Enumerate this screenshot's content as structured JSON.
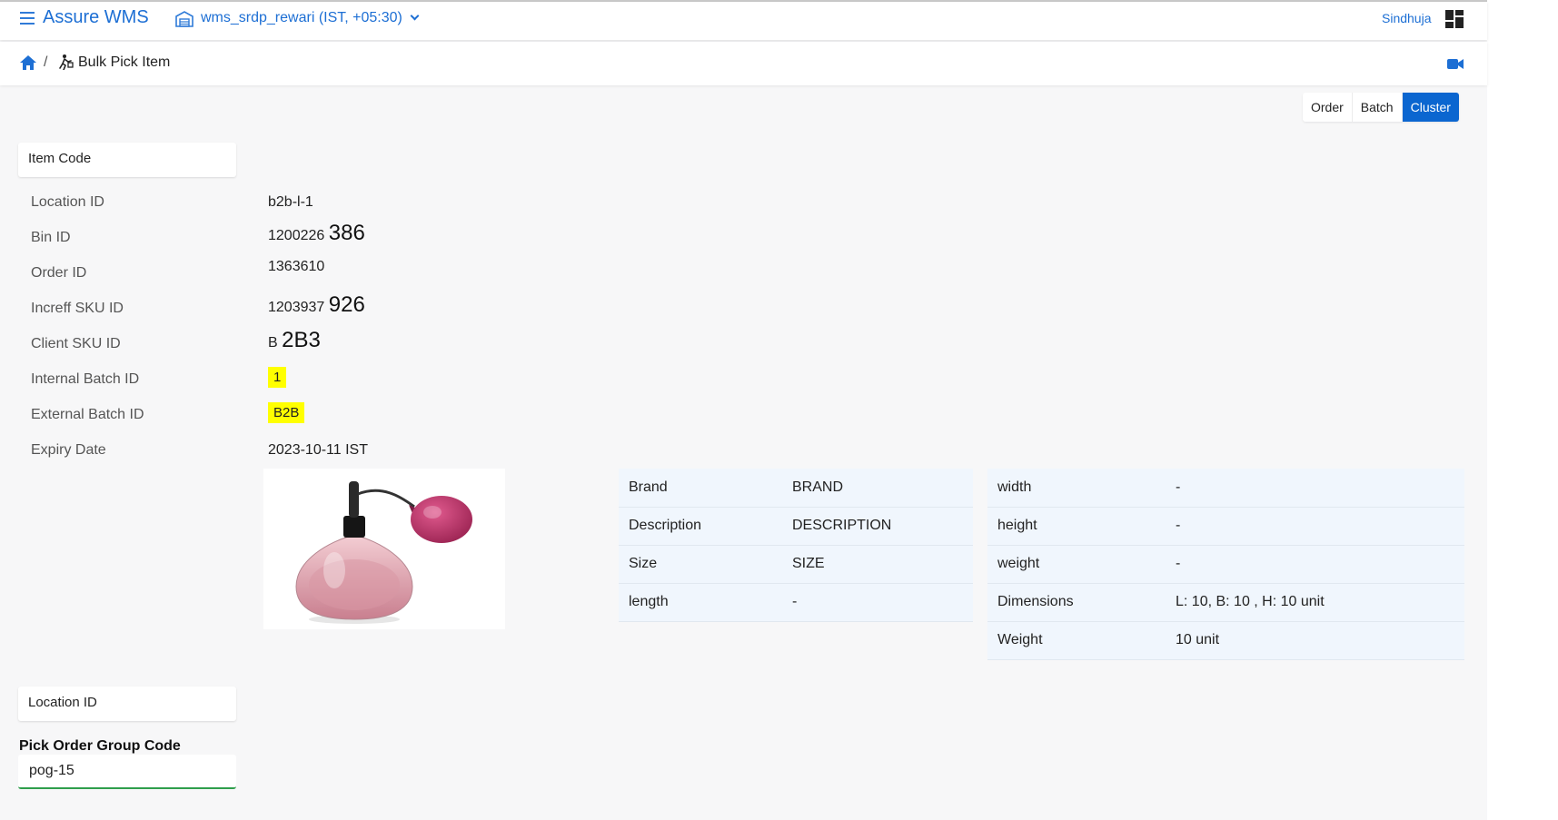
{
  "header": {
    "app_name": "Assure WMS",
    "warehouse": "wms_srdp_rewari",
    "timezone": "(IST, +05:30)",
    "user": "Sindhuja"
  },
  "breadcrumb": {
    "separator": "/",
    "title": "Bulk Pick Item"
  },
  "pick_modes": {
    "options": [
      "Order",
      "Batch",
      "Cluster"
    ],
    "selected": "Cluster"
  },
  "item_code_input": {
    "placeholder": "Item Code"
  },
  "item_info": {
    "location_id": {
      "label": "Location ID",
      "value": "b2b-l-1"
    },
    "bin_id": {
      "label": "Bin ID",
      "prefix": "1200226",
      "suffix": "386"
    },
    "order_id": {
      "label": "Order ID",
      "value": "1363610"
    },
    "increff_sku_id": {
      "label": "Increff SKU ID",
      "prefix": "1203937",
      "suffix": "926"
    },
    "client_sku_id": {
      "label": "Client SKU ID",
      "prefix": "B",
      "suffix": "2B3"
    },
    "internal_batch_id": {
      "label": "Internal Batch ID",
      "value": "1"
    },
    "external_batch_id": {
      "label": "External Batch ID",
      "value": "B2B"
    },
    "expiry_date": {
      "label": "Expiry Date",
      "value": "2023-10-11 IST"
    }
  },
  "attributes_left": [
    {
      "key": "Brand",
      "value": "BRAND"
    },
    {
      "key": "Description",
      "value": "DESCRIPTION"
    },
    {
      "key": "Size",
      "value": "SIZE"
    },
    {
      "key": "length",
      "value": "-"
    }
  ],
  "attributes_right": [
    {
      "key": "width",
      "value": "-"
    },
    {
      "key": "height",
      "value": "-"
    },
    {
      "key": "weight",
      "value": "-"
    },
    {
      "key": "Dimensions",
      "value": "L: 10, B: 10 , H: 10 unit"
    },
    {
      "key": "Weight",
      "value": "10 unit"
    }
  ],
  "location_input": {
    "placeholder": "Location ID"
  },
  "pick_order_group": {
    "label": "Pick Order Group Code",
    "value": "pog-15"
  },
  "colors": {
    "accent": "#0b66d0",
    "highlight": "#ffff00",
    "success": "#2e9e4b"
  },
  "icons": [
    "menu-icon",
    "warehouse-icon",
    "chevron-down-icon",
    "grid-icon",
    "home-icon",
    "pick-icon",
    "video-icon"
  ]
}
